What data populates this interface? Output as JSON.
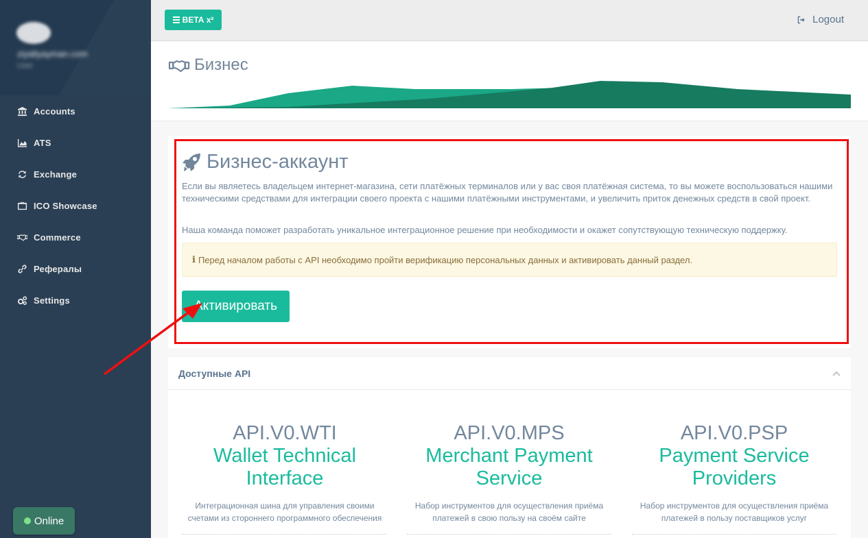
{
  "sidebar": {
    "profile": {
      "email": "ziyaliyayman.com",
      "role": "User"
    },
    "items": [
      {
        "label": "Accounts",
        "icon": "bank-icon"
      },
      {
        "label": "ATS",
        "icon": "area-chart-icon"
      },
      {
        "label": "Exchange",
        "icon": "refresh-icon"
      },
      {
        "label": "ICO Showcase",
        "icon": "briefcase-icon"
      },
      {
        "label": "Commerce",
        "icon": "handshake-icon"
      },
      {
        "label": "Рефералы",
        "icon": "link-icon"
      },
      {
        "label": "Settings",
        "icon": "gears-icon"
      }
    ],
    "online_label": "Online"
  },
  "topbar": {
    "beta_label": "BETA",
    "beta_sup": "x²",
    "logout_label": "Logout"
  },
  "header": {
    "title": "Бизнес"
  },
  "business": {
    "title": "Бизнес-аккаунт",
    "paragraph1": "Если вы являетесь владельцем интернет-магазина, сети платёжных терминалов или у вас своя платёжная система, то вы можете воспользоваться нашими техническими средствами для интеграции своего проекта с нашими платёжными инструментами, и увеличить приток денежных средств в свой проект.",
    "paragraph2": "Наша команда поможет разработать уникальное интеграционное решение при необходимости и окажет сопутствующую техническую поддержку.",
    "alert": "Перед началом работы с API необходимо пройти верификацию персональных данных и активировать данный раздел.",
    "activate_label": "Активировать"
  },
  "api_panel": {
    "title": "Доступные API",
    "items": [
      {
        "code": "API.V0.WTI",
        "name": "Wallet Technical Interface",
        "desc": "Интеграционная шина для управления своими счетами из стороннего программного обеспечения"
      },
      {
        "code": "API.V0.MPS",
        "name": "Merchant Payment Service",
        "desc": "Набор инструментов для осуществления приёма платежей в свою пользу на своём сайте"
      },
      {
        "code": "API.V0.PSP",
        "name": "Payment Service Providers",
        "desc": "Набор инструментов для осуществления приёма платежей в пользу поставщиков услуг"
      }
    ]
  },
  "colors": {
    "accent": "#1abb9c",
    "sidebar": "#2a3f54",
    "highlight": "#ee1010"
  }
}
